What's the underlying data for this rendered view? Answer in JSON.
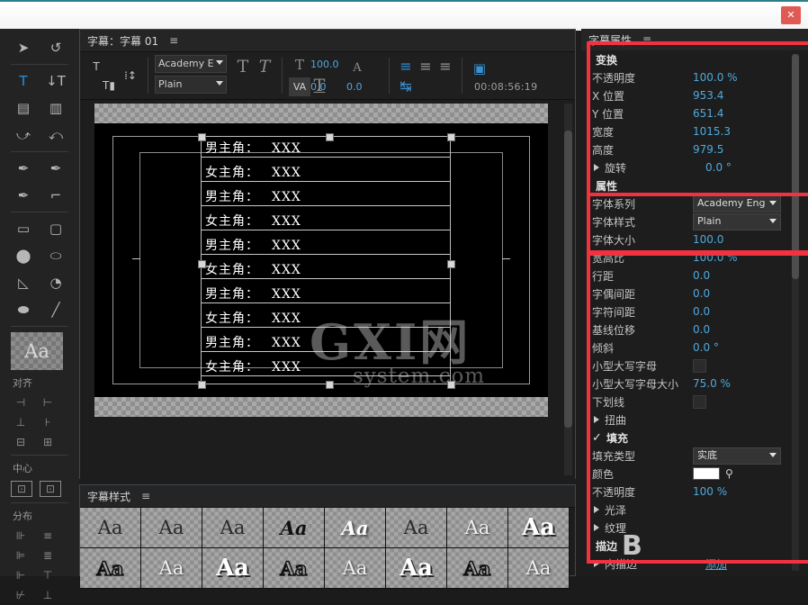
{
  "window": {
    "close_label": "✕"
  },
  "tools": {
    "items": [
      {
        "name": "selection-tool",
        "glyph": "➤",
        "selected": false
      },
      {
        "name": "rotate-tool",
        "glyph": "↺",
        "selected": false
      },
      {
        "name": "type-tool",
        "glyph": "T",
        "selected": true
      },
      {
        "name": "vertical-type-tool",
        "glyph": "↓T",
        "selected": false
      },
      {
        "name": "area-type-tool",
        "glyph": "▤",
        "selected": false
      },
      {
        "name": "vertical-area-type-tool",
        "glyph": "▥",
        "selected": false
      },
      {
        "name": "path-type-tool",
        "glyph": "⤻",
        "selected": false
      },
      {
        "name": "vertical-path-type-tool",
        "glyph": "⤺",
        "selected": false
      },
      {
        "name": "pen-tool",
        "glyph": "✒",
        "selected": false
      },
      {
        "name": "delete-anchor-tool",
        "glyph": "✒",
        "selected": false
      },
      {
        "name": "add-anchor-tool",
        "glyph": "✒",
        "selected": false
      },
      {
        "name": "convert-anchor-tool",
        "glyph": "⌐",
        "selected": false
      },
      {
        "name": "rectangle-tool",
        "glyph": "▭",
        "selected": false
      },
      {
        "name": "rounded-rect-tool",
        "glyph": "▢",
        "selected": false
      },
      {
        "name": "clipped-rect-tool",
        "glyph": "⬤",
        "selected": false
      },
      {
        "name": "wedge-tool",
        "glyph": "⬭",
        "selected": false
      },
      {
        "name": "triangle-tool",
        "glyph": "◺",
        "selected": false
      },
      {
        "name": "arc-tool",
        "glyph": "◔",
        "selected": false
      },
      {
        "name": "ellipse-tool",
        "glyph": "⬬",
        "selected": false
      },
      {
        "name": "line-tool",
        "glyph": "╱",
        "selected": false
      }
    ],
    "style_preview_label": "Aa",
    "align": {
      "title": "对齐",
      "buttons": [
        "⊣",
        "⊢",
        "⊥",
        "⊦",
        "⊟",
        "⊞"
      ]
    },
    "center": {
      "title": "中心",
      "buttons": [
        "⊡",
        "⊡"
      ]
    },
    "distribute": {
      "title": "分布",
      "buttons": [
        "⊪",
        "≡",
        "⊫",
        "≣",
        "⊩",
        "⊤",
        "⊬",
        "⊥"
      ]
    }
  },
  "monitor": {
    "title": "字幕：字幕 01",
    "menu_icon": "≡",
    "toolbar": {
      "new_title_icon": "T",
      "tab_stops_icon": "⁞↕",
      "roll_crawl_icon": "T▮",
      "font_family": "Academy E",
      "font_style": "Plain",
      "bold_icon": "T",
      "italic_icon": "T",
      "underline_icon": "T",
      "font_size_icon": "T",
      "font_size_value": "100.0",
      "kerning_icon": "VA",
      "kerning_value": "0.0",
      "leading_icon": "A",
      "leading_value": "0.0",
      "align_left_icon": "≡",
      "align_center_icon": "≡",
      "align_right_icon": "≡",
      "tab_icon": "↹",
      "show_video_icon": "▣",
      "timecode": "00:08:56:19"
    },
    "canvas": {
      "lines": [
        {
          "label": "男主角：",
          "value": "XXX"
        },
        {
          "label": "女主角：",
          "value": "XXX"
        },
        {
          "label": "男主角：",
          "value": "XXX"
        },
        {
          "label": "女主角：",
          "value": "XXX"
        },
        {
          "label": "男主角：",
          "value": "XXX"
        },
        {
          "label": "女主角：",
          "value": "XXX"
        },
        {
          "label": "男主角：",
          "value": "XXX"
        },
        {
          "label": "女主角：",
          "value": "XXX"
        },
        {
          "label": "男主角：",
          "value": "XXX"
        },
        {
          "label": "女主角：",
          "value": "XXX"
        }
      ],
      "watermark_line1": "GXI网",
      "watermark_line2": "system.com"
    }
  },
  "styles_panel": {
    "title": "字幕样式",
    "menu_icon": "≡",
    "swatch_label": "Aa",
    "row1": [
      "Aa",
      "Aa",
      "Aa",
      "Aa",
      "Aa",
      "Aa",
      "Aa",
      "Aa"
    ],
    "row2": [
      "Aa",
      "Aa",
      "Aa",
      "Aa",
      "Aa",
      "Aa",
      "Aa",
      "Aa"
    ]
  },
  "properties": {
    "title": "字幕属性",
    "menu_icon": "≡",
    "rows": [
      {
        "name": "变换",
        "value": "",
        "type": "section"
      },
      {
        "name": "不透明度",
        "value": "100.0 %",
        "type": "value"
      },
      {
        "name": "X 位置",
        "value": "953.4",
        "type": "value"
      },
      {
        "name": "Y 位置",
        "value": "651.4",
        "type": "value"
      },
      {
        "name": "宽度",
        "value": "1015.3",
        "type": "value"
      },
      {
        "name": "高度",
        "value": "979.5",
        "type": "value"
      },
      {
        "name": "旋转",
        "value": "0.0 °",
        "type": "twirl"
      },
      {
        "name": "属性",
        "value": "",
        "type": "section"
      },
      {
        "name": "字体系列",
        "value": "Academy Eng",
        "type": "dropdown"
      },
      {
        "name": "字体样式",
        "value": "Plain",
        "type": "dropdown"
      },
      {
        "name": "字体大小",
        "value": "100.0",
        "type": "value"
      },
      {
        "name": "宽高比",
        "value": "100.0 %",
        "type": "value"
      },
      {
        "name": "行距",
        "value": "0.0",
        "type": "value"
      },
      {
        "name": "字偶间距",
        "value": "0.0",
        "type": "value"
      },
      {
        "name": "字符间距",
        "value": "0.0",
        "type": "value"
      },
      {
        "name": "基线位移",
        "value": "0.0",
        "type": "value"
      },
      {
        "name": "倾斜",
        "value": "0.0 °",
        "type": "value"
      },
      {
        "name": "小型大写字母",
        "value": "",
        "type": "checkbox"
      },
      {
        "name": "小型大写字母大小",
        "value": "75.0 %",
        "type": "value"
      },
      {
        "name": "下划线",
        "value": "",
        "type": "checkbox"
      },
      {
        "name": "扭曲",
        "value": "",
        "type": "twirl"
      },
      {
        "name": "填充",
        "value": "",
        "type": "checked-section"
      },
      {
        "name": "填充类型",
        "value": "实底",
        "type": "dropdown"
      },
      {
        "name": "颜色",
        "value": "",
        "type": "color"
      },
      {
        "name": "不透明度",
        "value": "100 %",
        "type": "value"
      },
      {
        "name": "光泽",
        "value": "",
        "type": "twirl"
      },
      {
        "name": "纹理",
        "value": "",
        "type": "twirl"
      },
      {
        "name": "描边",
        "value": "",
        "type": "section"
      },
      {
        "name": "内描边",
        "value": "添加",
        "type": "twirl-link"
      }
    ],
    "color_hex": "#ffffff",
    "eyedropper_icon": "⚲"
  },
  "annotations": {
    "color": "#f2323f",
    "boxes": [
      "transform-section-highlight",
      "font-section-highlight",
      "attributes-section-highlight"
    ]
  },
  "bottom_watermark": "B"
}
